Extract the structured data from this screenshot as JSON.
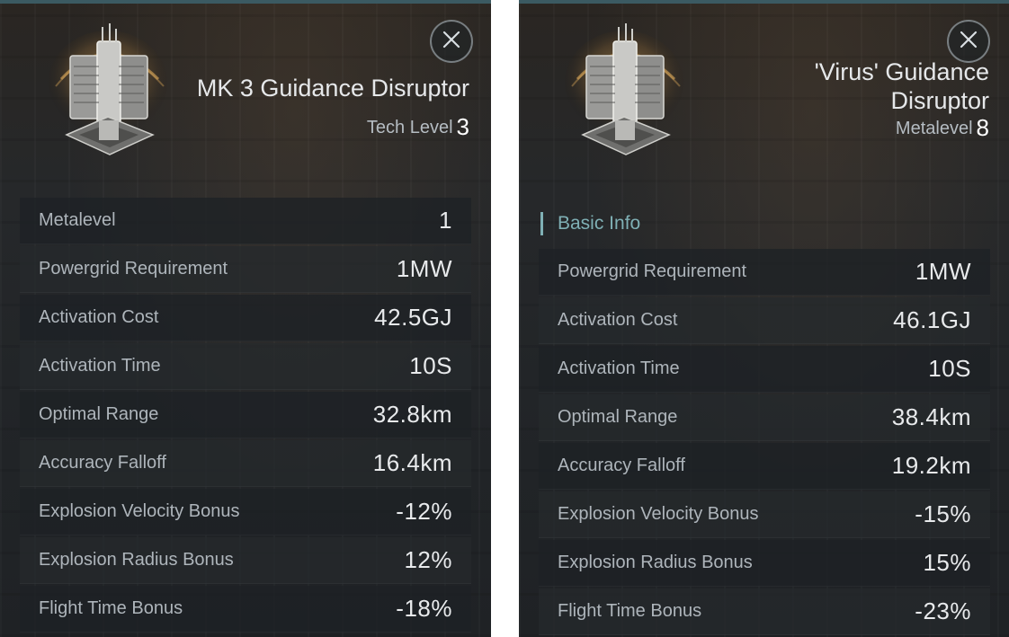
{
  "left": {
    "title": "MK 3 Guidance Disruptor",
    "level_label": "Tech Level",
    "level_value": "3",
    "icon": "guidance-disruptor-module-icon",
    "close_icon": "close-icon",
    "stats": [
      {
        "label": "Metalevel",
        "value": "1"
      },
      {
        "label": "Powergrid Requirement",
        "value": "1MW"
      },
      {
        "label": "Activation Cost",
        "value": "42.5GJ"
      },
      {
        "label": "Activation Time",
        "value": "10S"
      },
      {
        "label": "Optimal Range",
        "value": "32.8km"
      },
      {
        "label": "Accuracy Falloff",
        "value": "16.4km"
      },
      {
        "label": "Explosion Velocity Bonus",
        "value": "-12%"
      },
      {
        "label": "Explosion Radius Bonus",
        "value": "12%"
      },
      {
        "label": "Flight Time Bonus",
        "value": "-18%"
      }
    ]
  },
  "right": {
    "title": "'Virus' Guidance Disruptor",
    "level_label": "Metalevel",
    "level_value": "8",
    "icon": "guidance-disruptor-module-icon",
    "close_icon": "close-icon",
    "section_header": "Basic Info",
    "stats": [
      {
        "label": "Powergrid Requirement",
        "value": "1MW"
      },
      {
        "label": "Activation Cost",
        "value": "46.1GJ"
      },
      {
        "label": "Activation Time",
        "value": "10S"
      },
      {
        "label": "Optimal Range",
        "value": "38.4km"
      },
      {
        "label": "Accuracy Falloff",
        "value": "19.2km"
      },
      {
        "label": "Explosion Velocity Bonus",
        "value": "-15%"
      },
      {
        "label": "Explosion Radius Bonus",
        "value": "15%"
      },
      {
        "label": "Flight Time Bonus",
        "value": "-23%"
      }
    ]
  },
  "colors": {
    "accent": "#7fb0b5",
    "text_primary": "#e8eaec",
    "text_secondary": "#aeb5bb"
  }
}
